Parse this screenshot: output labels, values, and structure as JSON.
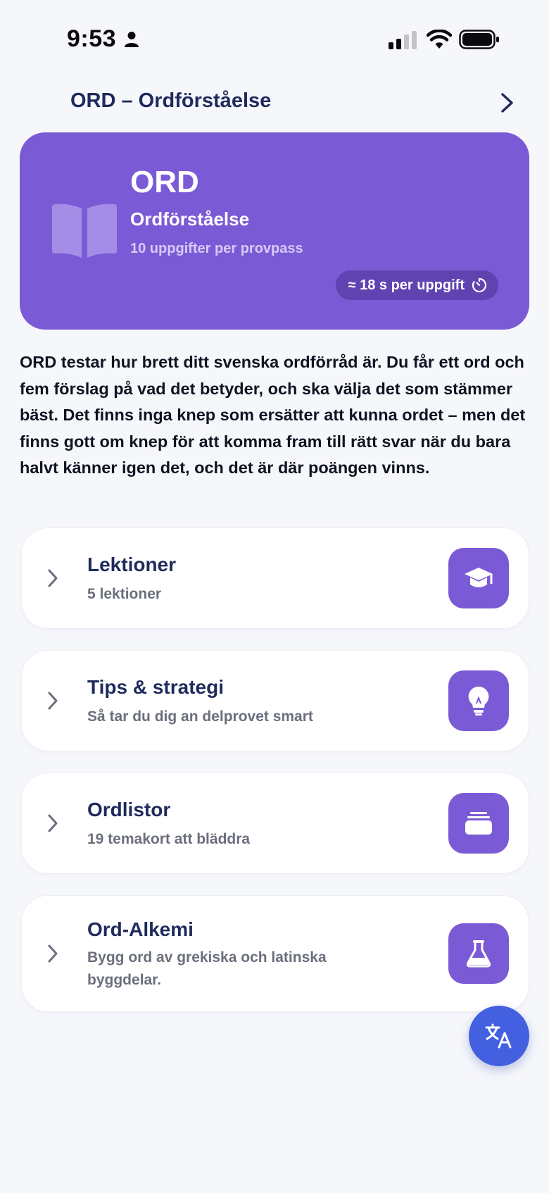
{
  "status_bar": {
    "time": "9:53"
  },
  "header": {
    "title": "ORD – Ordförståelse"
  },
  "hero": {
    "title": "ORD",
    "subtitle": "Ordförståelse",
    "meta": "10 uppgifter per provpass",
    "pill": "≈ 18 s per uppgift"
  },
  "intro": "ORD testar hur brett ditt svenska ordförråd är. Du får ett ord och fem förslag på vad det betyder, och ska välja det som stämmer bäst. Det finns inga knep som ersätter att kunna ordet – men det finns gott om knep för att komma fram till rätt svar när du bara halvt känner igen det, och det är där poängen vinns.",
  "cards": [
    {
      "title": "Lektioner",
      "subtitle": "5 lektioner",
      "icon": "graduation-cap-icon"
    },
    {
      "title": "Tips & strategi",
      "subtitle": "Så tar du dig an delprovet smart",
      "icon": "lightbulb-icon"
    },
    {
      "title": "Ordlistor",
      "subtitle": "19 temakort att bläddra",
      "icon": "card-stack-icon"
    },
    {
      "title": "Ord-Alkemi",
      "subtitle": "Bygg ord av grekiska och latinska byggdelar.",
      "icon": "flask-icon"
    }
  ],
  "fab": {
    "icon": "translate-icon"
  },
  "colors": {
    "accent": "#7b5ad6",
    "fab": "#4360e0",
    "title": "#1f2a5c",
    "background": "#f6f7fb"
  }
}
